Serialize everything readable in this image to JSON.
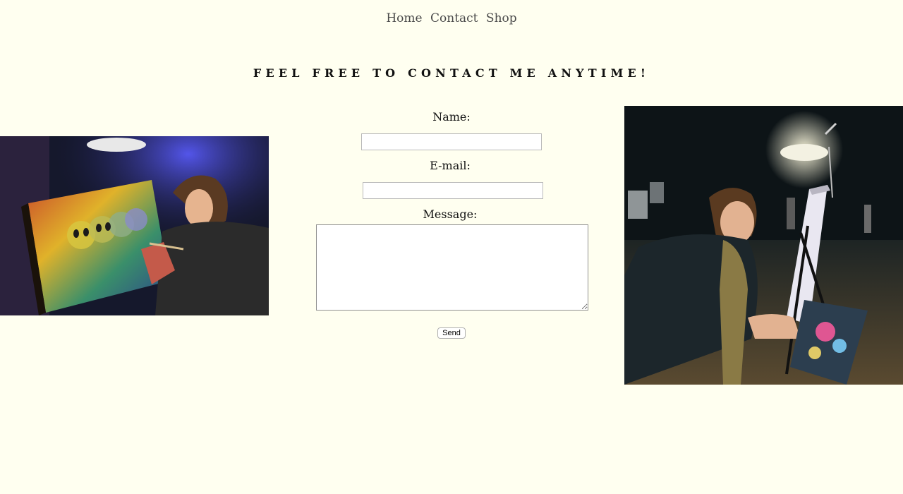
{
  "nav": {
    "items": [
      "Home",
      "Contact",
      "Shop"
    ]
  },
  "heading": "FEEL FREE TO CONTACT ME ANYTIME!",
  "form": {
    "name_label": "Name:",
    "name_value": "",
    "email_label": "E-mail:",
    "email_value": "",
    "message_label": "Message:",
    "message_value": "",
    "send_label": "Send"
  },
  "colors": {
    "background": "#fffff0",
    "nav_link": "#4a4a4a",
    "text": "#111111"
  }
}
